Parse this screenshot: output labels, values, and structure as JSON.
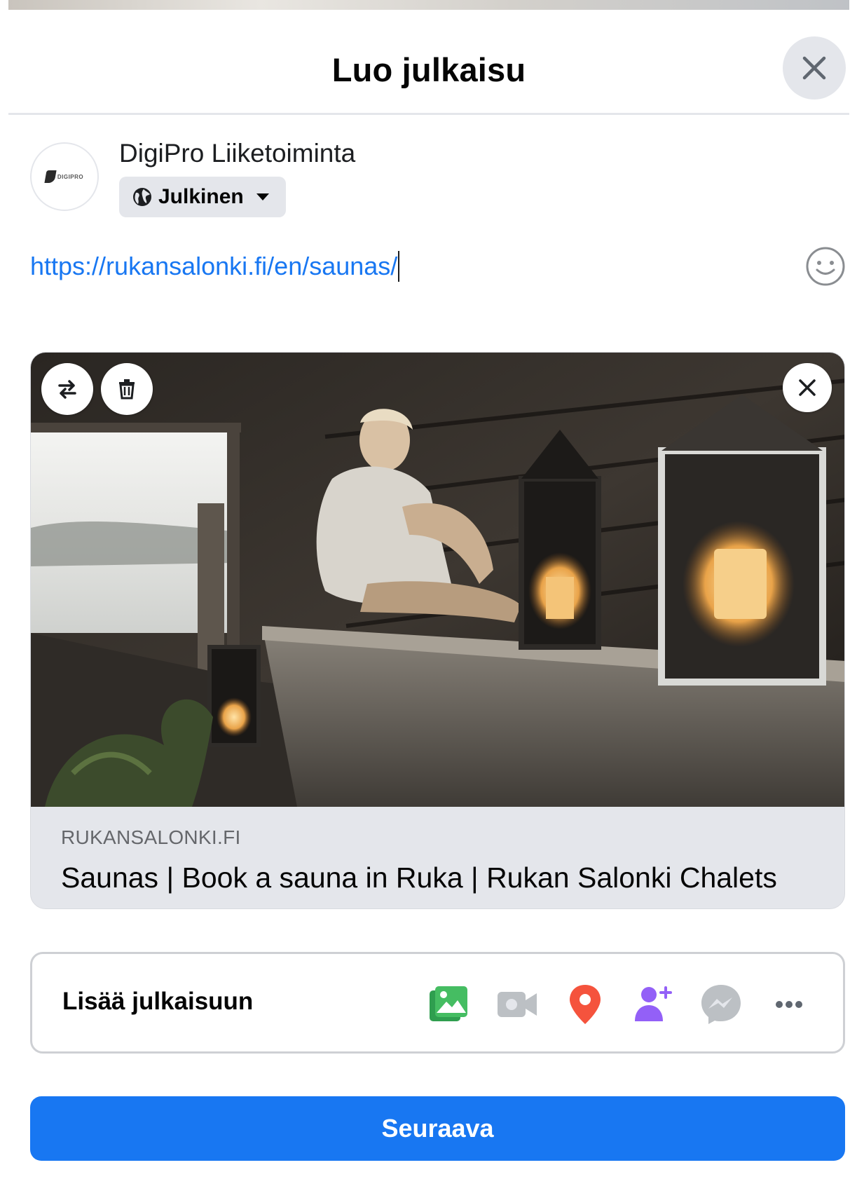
{
  "dialog": {
    "title": "Luo julkaisu",
    "close_icon": "close-icon"
  },
  "author": {
    "name": "DigiPro Liiketoiminta",
    "avatar_logo_text": "DIGIPRO",
    "audience_label": "Julkinen",
    "audience_icon": "globe-icon"
  },
  "composer": {
    "text": "https://rukansalonki.fi/en/saunas/",
    "emoji_icon": "smiley-icon"
  },
  "link_preview": {
    "domain": "RUKANSALONKI.FI",
    "title": "Saunas | Book a sauna in Ruka | Rukan Salonki Chalets",
    "image_description_icon": "sauna-photo",
    "controls": [
      "swap-icon",
      "trash-icon",
      "close-icon"
    ]
  },
  "add_to_post": {
    "label": "Lisää julkaisuun",
    "icons": [
      "photo-video-icon",
      "video-camera-icon",
      "location-pin-icon",
      "tag-people-icon",
      "messenger-icon",
      "more-icon"
    ],
    "colors": {
      "photo": "#45bd62",
      "video_disabled": "#bcc0c4",
      "location": "#f5533d",
      "tag": "#9360f7",
      "messenger_disabled": "#bcc0c4"
    }
  },
  "actions": {
    "next_label": "Seuraava"
  },
  "colors": {
    "primary": "#1877f2",
    "link": "#1877f2",
    "surface": "#e4e6eb"
  }
}
